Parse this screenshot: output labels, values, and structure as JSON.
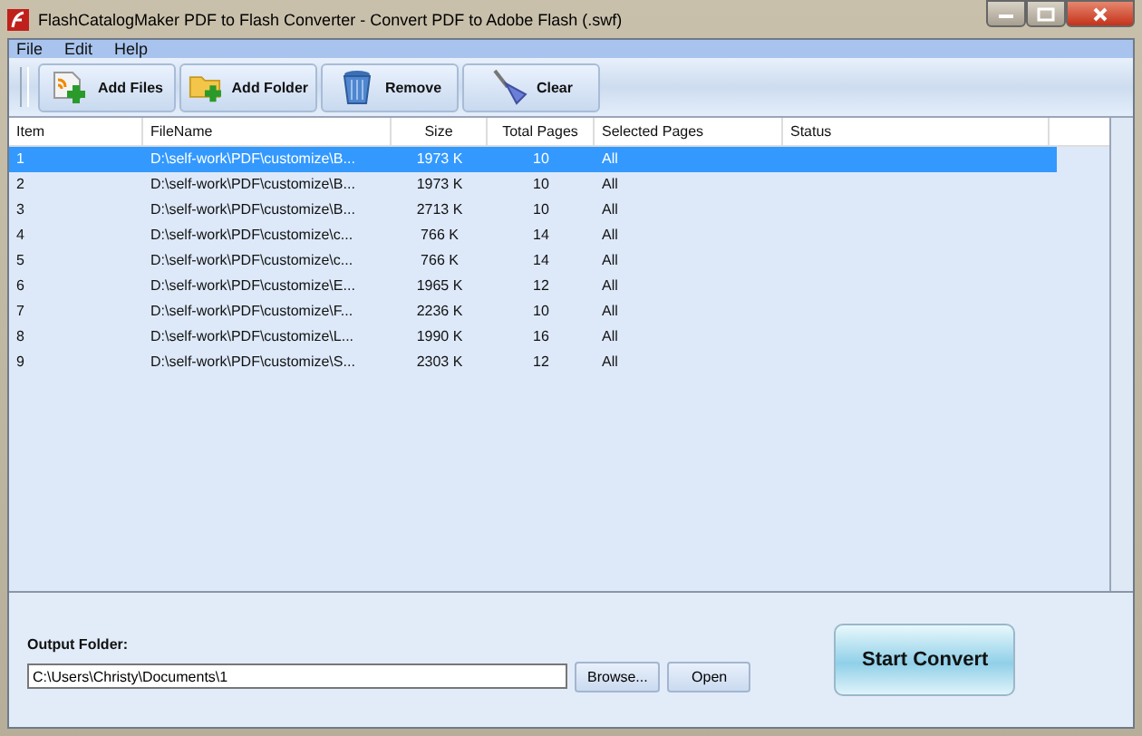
{
  "window": {
    "title": "FlashCatalogMaker PDF to Flash Converter - Convert PDF to Adobe Flash (.swf)"
  },
  "menu": [
    "File",
    "Edit",
    "Help"
  ],
  "toolbar": [
    {
      "kind": "add-files",
      "label": "Add Files"
    },
    {
      "kind": "add-folder",
      "label": "Add Folder"
    },
    {
      "kind": "remove",
      "label": "Remove"
    },
    {
      "kind": "clear",
      "label": "Clear"
    }
  ],
  "table": {
    "columns": [
      "Item",
      "FileName",
      "Size",
      "Total Pages",
      "Selected Pages",
      "Status"
    ],
    "rows": [
      {
        "cells": [
          "1",
          "D:\\self-work\\PDF\\customize\\B...",
          "1973 K",
          "10",
          "All"
        ],
        "selected": true
      },
      {
        "cells": [
          "2",
          "D:\\self-work\\PDF\\customize\\B...",
          "1973 K",
          "10",
          "All"
        ],
        "selected": false
      },
      {
        "cells": [
          "3",
          "D:\\self-work\\PDF\\customize\\B...",
          "2713 K",
          "10",
          "All"
        ],
        "selected": false
      },
      {
        "cells": [
          "4",
          "D:\\self-work\\PDF\\customize\\c...",
          "766 K",
          "14",
          "All"
        ],
        "selected": false
      },
      {
        "cells": [
          "5",
          "D:\\self-work\\PDF\\customize\\c...",
          "766 K",
          "14",
          "All"
        ],
        "selected": false
      },
      {
        "cells": [
          "6",
          "D:\\self-work\\PDF\\customize\\E...",
          "1965 K",
          "12",
          "All"
        ],
        "selected": false
      },
      {
        "cells": [
          "7",
          "D:\\self-work\\PDF\\customize\\F...",
          "2236 K",
          "10",
          "All"
        ],
        "selected": false
      },
      {
        "cells": [
          "8",
          "D:\\self-work\\PDF\\customize\\L...",
          "1990 K",
          "16",
          "All"
        ],
        "selected": false
      },
      {
        "cells": [
          "9",
          "D:\\self-work\\PDF\\customize\\S...",
          "2303 K",
          "12",
          "All"
        ],
        "selected": false
      }
    ]
  },
  "output": {
    "label": "Output Folder:",
    "value": "C:\\Users\\Christy\\Documents\\1",
    "browse": "Browse...",
    "open": "Open"
  },
  "start_button": "Start Convert"
}
